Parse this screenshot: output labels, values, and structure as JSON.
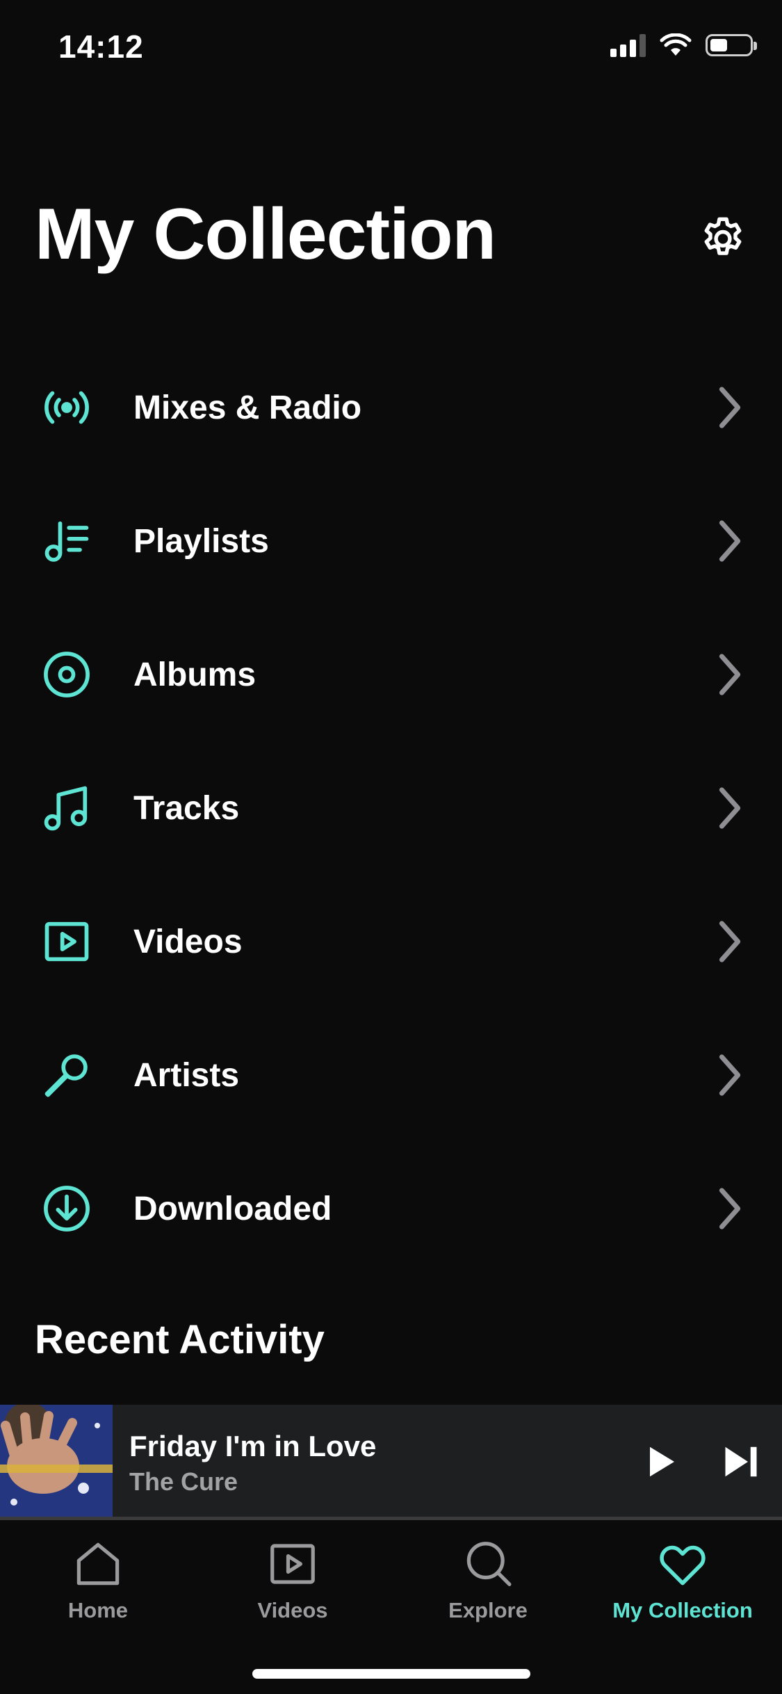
{
  "status_bar": {
    "time": "14:12"
  },
  "header": {
    "title": "My Collection"
  },
  "menu": {
    "items": [
      {
        "label": "Mixes & Radio",
        "icon": "radio-broadcast-icon"
      },
      {
        "label": "Playlists",
        "icon": "playlist-icon"
      },
      {
        "label": "Albums",
        "icon": "album-disc-icon"
      },
      {
        "label": "Tracks",
        "icon": "music-note-icon"
      },
      {
        "label": "Videos",
        "icon": "video-play-icon"
      },
      {
        "label": "Artists",
        "icon": "microphone-icon"
      },
      {
        "label": "Downloaded",
        "icon": "download-icon"
      }
    ]
  },
  "recent_activity": {
    "title": "Recent Activity"
  },
  "now_playing": {
    "title": "Friday I'm in Love",
    "artist": "The Cure",
    "progress": 0
  },
  "tab_bar": {
    "tabs": [
      {
        "label": "Home",
        "icon": "home-icon"
      },
      {
        "label": "Videos",
        "icon": "video-icon"
      },
      {
        "label": "Explore",
        "icon": "search-icon"
      },
      {
        "label": "My Collection",
        "icon": "heart-icon"
      }
    ],
    "active": "My Collection"
  },
  "colors": {
    "accent": "#5ee4d3",
    "background": "#0b0b0c",
    "player_background": "#1e1f21",
    "inactive_text": "#9b9b9e"
  }
}
